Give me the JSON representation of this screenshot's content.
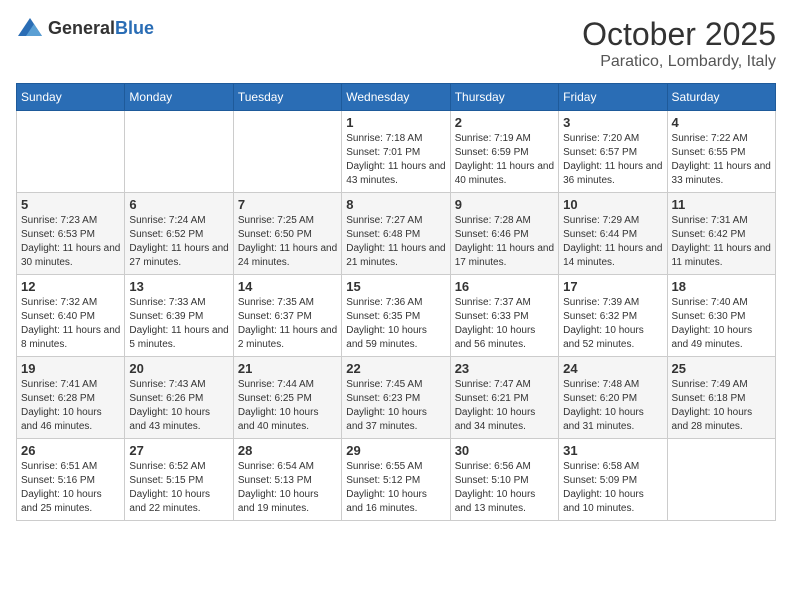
{
  "logo": {
    "text_general": "General",
    "text_blue": "Blue"
  },
  "title": {
    "month": "October 2025",
    "location": "Paratico, Lombardy, Italy"
  },
  "weekdays": [
    "Sunday",
    "Monday",
    "Tuesday",
    "Wednesday",
    "Thursday",
    "Friday",
    "Saturday"
  ],
  "weeks": [
    [
      {
        "day": "",
        "sunrise": "",
        "sunset": "",
        "daylight": ""
      },
      {
        "day": "",
        "sunrise": "",
        "sunset": "",
        "daylight": ""
      },
      {
        "day": "",
        "sunrise": "",
        "sunset": "",
        "daylight": ""
      },
      {
        "day": "1",
        "sunrise": "Sunrise: 7:18 AM",
        "sunset": "Sunset: 7:01 PM",
        "daylight": "Daylight: 11 hours and 43 minutes."
      },
      {
        "day": "2",
        "sunrise": "Sunrise: 7:19 AM",
        "sunset": "Sunset: 6:59 PM",
        "daylight": "Daylight: 11 hours and 40 minutes."
      },
      {
        "day": "3",
        "sunrise": "Sunrise: 7:20 AM",
        "sunset": "Sunset: 6:57 PM",
        "daylight": "Daylight: 11 hours and 36 minutes."
      },
      {
        "day": "4",
        "sunrise": "Sunrise: 7:22 AM",
        "sunset": "Sunset: 6:55 PM",
        "daylight": "Daylight: 11 hours and 33 minutes."
      }
    ],
    [
      {
        "day": "5",
        "sunrise": "Sunrise: 7:23 AM",
        "sunset": "Sunset: 6:53 PM",
        "daylight": "Daylight: 11 hours and 30 minutes."
      },
      {
        "day": "6",
        "sunrise": "Sunrise: 7:24 AM",
        "sunset": "Sunset: 6:52 PM",
        "daylight": "Daylight: 11 hours and 27 minutes."
      },
      {
        "day": "7",
        "sunrise": "Sunrise: 7:25 AM",
        "sunset": "Sunset: 6:50 PM",
        "daylight": "Daylight: 11 hours and 24 minutes."
      },
      {
        "day": "8",
        "sunrise": "Sunrise: 7:27 AM",
        "sunset": "Sunset: 6:48 PM",
        "daylight": "Daylight: 11 hours and 21 minutes."
      },
      {
        "day": "9",
        "sunrise": "Sunrise: 7:28 AM",
        "sunset": "Sunset: 6:46 PM",
        "daylight": "Daylight: 11 hours and 17 minutes."
      },
      {
        "day": "10",
        "sunrise": "Sunrise: 7:29 AM",
        "sunset": "Sunset: 6:44 PM",
        "daylight": "Daylight: 11 hours and 14 minutes."
      },
      {
        "day": "11",
        "sunrise": "Sunrise: 7:31 AM",
        "sunset": "Sunset: 6:42 PM",
        "daylight": "Daylight: 11 hours and 11 minutes."
      }
    ],
    [
      {
        "day": "12",
        "sunrise": "Sunrise: 7:32 AM",
        "sunset": "Sunset: 6:40 PM",
        "daylight": "Daylight: 11 hours and 8 minutes."
      },
      {
        "day": "13",
        "sunrise": "Sunrise: 7:33 AM",
        "sunset": "Sunset: 6:39 PM",
        "daylight": "Daylight: 11 hours and 5 minutes."
      },
      {
        "day": "14",
        "sunrise": "Sunrise: 7:35 AM",
        "sunset": "Sunset: 6:37 PM",
        "daylight": "Daylight: 11 hours and 2 minutes."
      },
      {
        "day": "15",
        "sunrise": "Sunrise: 7:36 AM",
        "sunset": "Sunset: 6:35 PM",
        "daylight": "Daylight: 10 hours and 59 minutes."
      },
      {
        "day": "16",
        "sunrise": "Sunrise: 7:37 AM",
        "sunset": "Sunset: 6:33 PM",
        "daylight": "Daylight: 10 hours and 56 minutes."
      },
      {
        "day": "17",
        "sunrise": "Sunrise: 7:39 AM",
        "sunset": "Sunset: 6:32 PM",
        "daylight": "Daylight: 10 hours and 52 minutes."
      },
      {
        "day": "18",
        "sunrise": "Sunrise: 7:40 AM",
        "sunset": "Sunset: 6:30 PM",
        "daylight": "Daylight: 10 hours and 49 minutes."
      }
    ],
    [
      {
        "day": "19",
        "sunrise": "Sunrise: 7:41 AM",
        "sunset": "Sunset: 6:28 PM",
        "daylight": "Daylight: 10 hours and 46 minutes."
      },
      {
        "day": "20",
        "sunrise": "Sunrise: 7:43 AM",
        "sunset": "Sunset: 6:26 PM",
        "daylight": "Daylight: 10 hours and 43 minutes."
      },
      {
        "day": "21",
        "sunrise": "Sunrise: 7:44 AM",
        "sunset": "Sunset: 6:25 PM",
        "daylight": "Daylight: 10 hours and 40 minutes."
      },
      {
        "day": "22",
        "sunrise": "Sunrise: 7:45 AM",
        "sunset": "Sunset: 6:23 PM",
        "daylight": "Daylight: 10 hours and 37 minutes."
      },
      {
        "day": "23",
        "sunrise": "Sunrise: 7:47 AM",
        "sunset": "Sunset: 6:21 PM",
        "daylight": "Daylight: 10 hours and 34 minutes."
      },
      {
        "day": "24",
        "sunrise": "Sunrise: 7:48 AM",
        "sunset": "Sunset: 6:20 PM",
        "daylight": "Daylight: 10 hours and 31 minutes."
      },
      {
        "day": "25",
        "sunrise": "Sunrise: 7:49 AM",
        "sunset": "Sunset: 6:18 PM",
        "daylight": "Daylight: 10 hours and 28 minutes."
      }
    ],
    [
      {
        "day": "26",
        "sunrise": "Sunrise: 6:51 AM",
        "sunset": "Sunset: 5:16 PM",
        "daylight": "Daylight: 10 hours and 25 minutes."
      },
      {
        "day": "27",
        "sunrise": "Sunrise: 6:52 AM",
        "sunset": "Sunset: 5:15 PM",
        "daylight": "Daylight: 10 hours and 22 minutes."
      },
      {
        "day": "28",
        "sunrise": "Sunrise: 6:54 AM",
        "sunset": "Sunset: 5:13 PM",
        "daylight": "Daylight: 10 hours and 19 minutes."
      },
      {
        "day": "29",
        "sunrise": "Sunrise: 6:55 AM",
        "sunset": "Sunset: 5:12 PM",
        "daylight": "Daylight: 10 hours and 16 minutes."
      },
      {
        "day": "30",
        "sunrise": "Sunrise: 6:56 AM",
        "sunset": "Sunset: 5:10 PM",
        "daylight": "Daylight: 10 hours and 13 minutes."
      },
      {
        "day": "31",
        "sunrise": "Sunrise: 6:58 AM",
        "sunset": "Sunset: 5:09 PM",
        "daylight": "Daylight: 10 hours and 10 minutes."
      },
      {
        "day": "",
        "sunrise": "",
        "sunset": "",
        "daylight": ""
      }
    ]
  ]
}
